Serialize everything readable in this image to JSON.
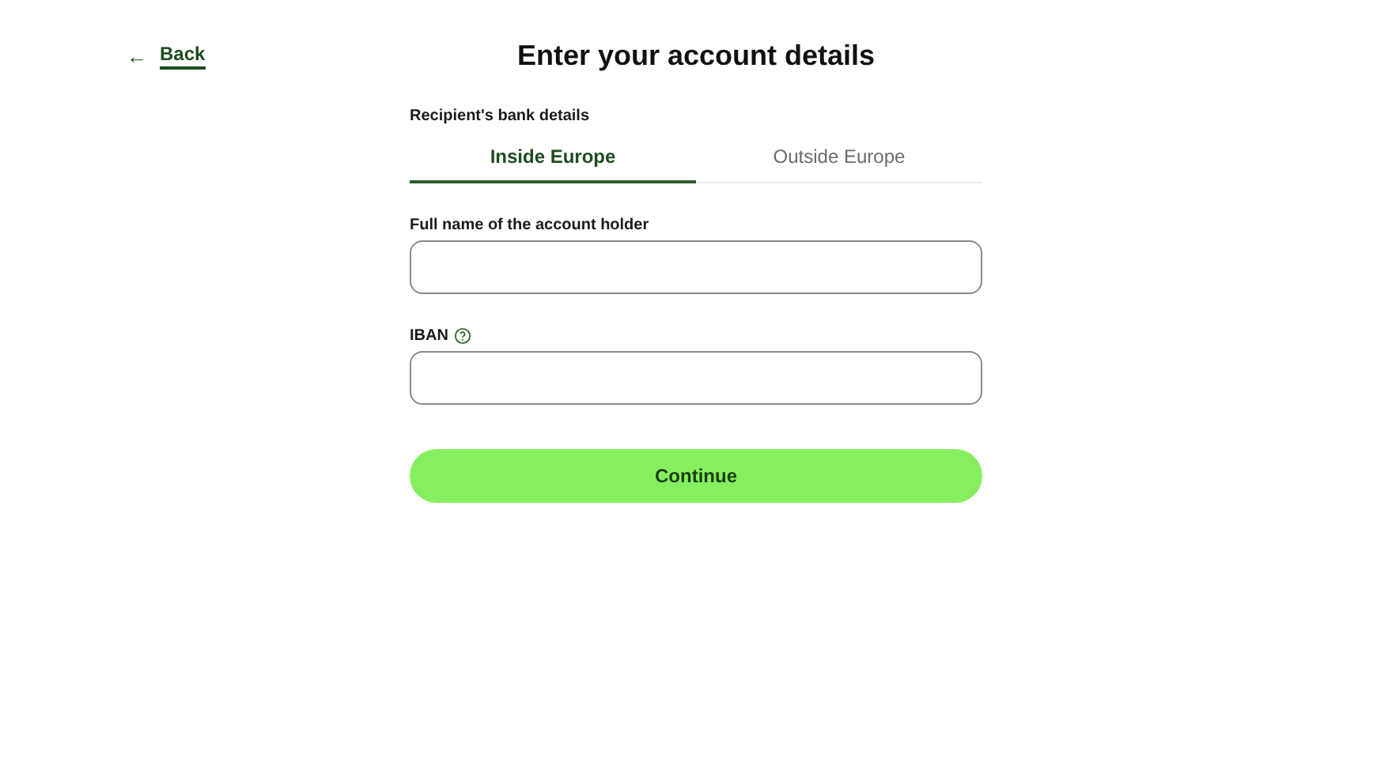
{
  "back_link": {
    "arrow": "←",
    "label": "Back"
  },
  "title": "Enter your account details",
  "section_label": "Recipient's bank details",
  "tabs": [
    {
      "label": "Inside Europe",
      "selected": true
    },
    {
      "label": "Outside Europe",
      "selected": false
    }
  ],
  "fields": [
    {
      "label": "Full name of the account holder",
      "help": false
    },
    {
      "label": "IBAN",
      "help": true
    }
  ],
  "continue_button": "Continue"
}
